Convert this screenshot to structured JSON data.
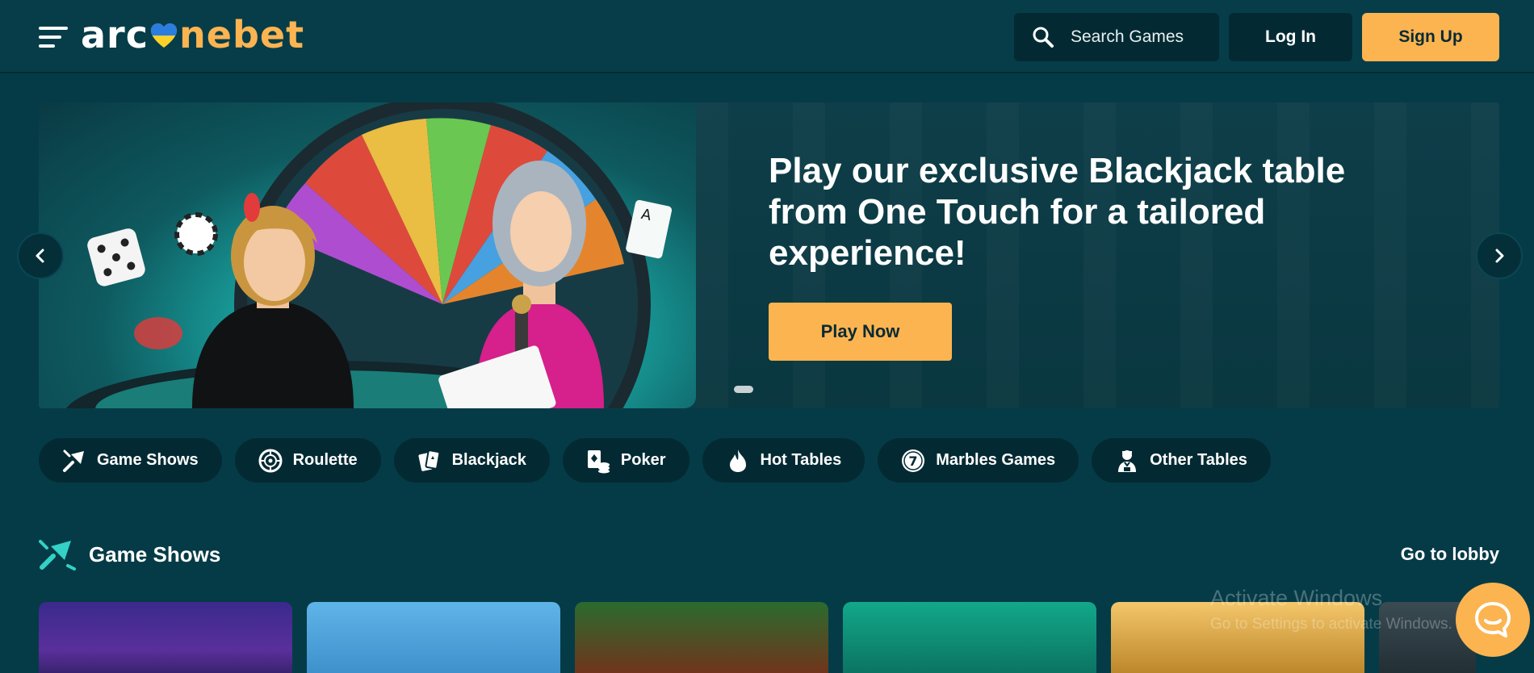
{
  "header": {
    "logo": {
      "part1": "arc",
      "part2": "ne",
      "part3": "bet"
    },
    "search_placeholder": "Search Games",
    "login_label": "Log In",
    "signup_label": "Sign Up"
  },
  "hero": {
    "title": "Play our exclusive Blackjack table from One Touch for a tailored experience!",
    "cta_label": "Play Now",
    "slide_count": 1,
    "active_slide": 1
  },
  "categories": [
    {
      "label": "Game Shows",
      "icon": "game-shows-icon"
    },
    {
      "label": "Roulette",
      "icon": "roulette-icon"
    },
    {
      "label": "Blackjack",
      "icon": "blackjack-icon"
    },
    {
      "label": "Poker",
      "icon": "poker-icon"
    },
    {
      "label": "Hot Tables",
      "icon": "flame-icon"
    },
    {
      "label": "Marbles Games",
      "icon": "marble-7-icon"
    },
    {
      "label": "Other Tables",
      "icon": "dealer-icon"
    }
  ],
  "section": {
    "title": "Game Shows",
    "lobby_label": "Go to lobby"
  },
  "watermark": {
    "line1": "Activate Windows",
    "line2": "Go to Settings to activate Windows."
  },
  "colors": {
    "background": "#053b47",
    "header": "#073d49",
    "dark_button": "#032a33",
    "accent": "#fcb451",
    "heart_blue": "#2b7de0",
    "heart_yellow": "#fcd12a"
  }
}
